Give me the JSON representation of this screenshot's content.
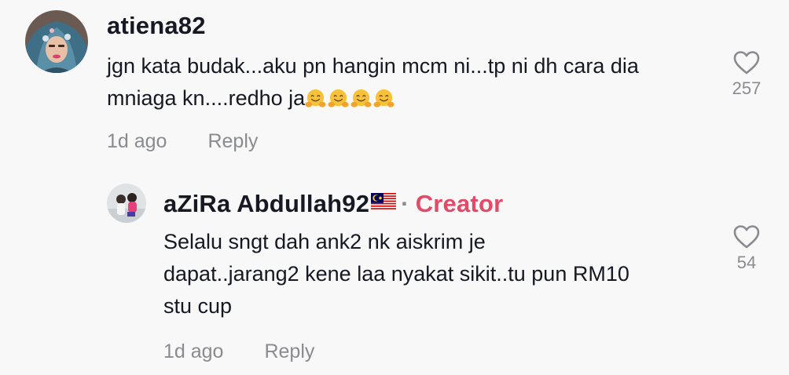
{
  "comments": [
    {
      "username": "atiena82",
      "text": "jgn kata budak...aku pn hangin mcm ni...tp ni dh cara dia mniaga kn....redho ja",
      "emojis": [
        "hugging-face-emoji",
        "hugging-face-emoji",
        "hugging-face-emoji",
        "hugging-face-emoji"
      ],
      "time": "1d ago",
      "reply_label": "Reply",
      "like_count": "257",
      "like_icon": "heart-outline-icon"
    },
    {
      "username": "aZiRa Abdullah92",
      "flag_icon": "malaysia-flag-icon",
      "separator": "·",
      "badge": "Creator",
      "text_line1": "Selalu sngt dah ank2 nk aiskrim je",
      "text_line2": "dapat..jarang2 kene laa nyakat sikit..tu pun RM10",
      "text_line3": "stu cup",
      "time": "1d ago",
      "reply_label": "Reply",
      "like_count": "54",
      "like_icon": "heart-outline-icon"
    }
  ],
  "colors": {
    "background": "#f8f8f8",
    "text": "#161823",
    "muted": "#8a8b91",
    "creator_badge": "#e14b67"
  }
}
